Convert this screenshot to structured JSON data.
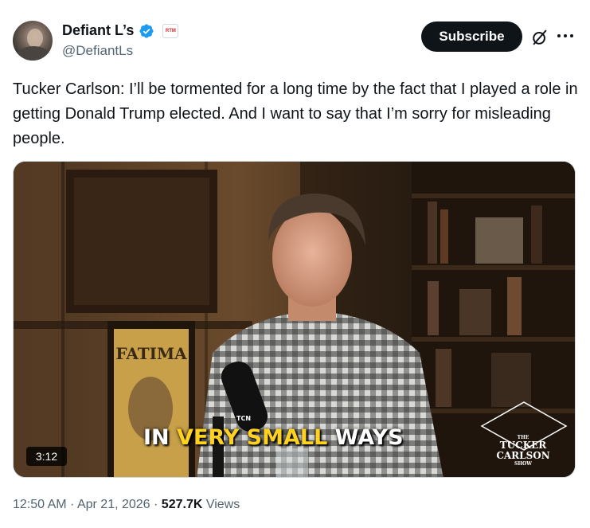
{
  "author": {
    "display_name": "Defiant L’s",
    "handle": "@DefiantLs",
    "affiliate_badge": "RTM",
    "verified_color": "#1d9bf0"
  },
  "actions": {
    "subscribe_label": "Subscribe"
  },
  "tweet": {
    "text": "Tucker Carlson: I’ll be tormented for a long time by the fact that I played a role in getting Donald Trump elected. And I want to say that I’m sorry for misleading people."
  },
  "media": {
    "duration": "3:12",
    "caption_prefix": "IN ",
    "caption_highlight": "VERY SMALL",
    "caption_suffix": " WAYS",
    "poster_text": "FATIMA",
    "mic_label": "TCN",
    "show_logo": {
      "the": "THE",
      "line1": "TUCKER",
      "line2": "CARLSON",
      "line3": "SHOW"
    }
  },
  "meta": {
    "time": "12:50 AM",
    "separator": " · ",
    "date": "Apr 21, 2026",
    "views_count": "527.7K",
    "views_label": " Views"
  },
  "colors": {
    "text": "#0f1419",
    "secondary_text": "#536471",
    "caption_highlight": "#ffd21f"
  },
  "icons": [
    "verified-icon",
    "affiliate-badge",
    "grok-icon",
    "more-icon"
  ]
}
